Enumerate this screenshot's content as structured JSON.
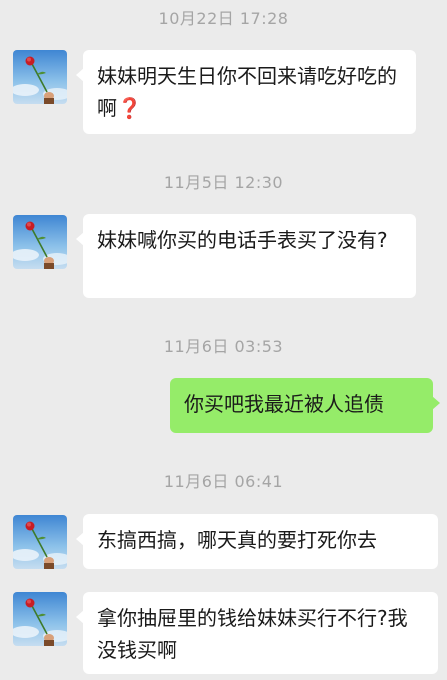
{
  "messages": [
    {
      "time": "10月22日 17:28",
      "text": "妹妹明天生日你不回来请吃好吃的啊",
      "emoji": "❓",
      "side": "left"
    },
    {
      "time": "11月5日 12:30",
      "text": "妹妹喊你买的电话手表买了没有?",
      "side": "left"
    },
    {
      "time": "11月6日 03:53",
      "text": "你买吧我最近被人追债",
      "side": "right"
    },
    {
      "time": "11月6日 06:41",
      "text": "东搞西搞，哪天真的要打死你去",
      "side": "left"
    },
    {
      "text": "拿你抽屉里的钱给妹妹买行不行?我没钱买啊",
      "side": "left"
    }
  ],
  "icons": {
    "avatar": "rose-avatar-icon",
    "question_mark": "red-question-mark-icon"
  },
  "colors": {
    "background": "#ebebeb",
    "bubble_in": "#ffffff",
    "bubble_out": "#95ec69",
    "timestamp": "#a5a5a5"
  }
}
